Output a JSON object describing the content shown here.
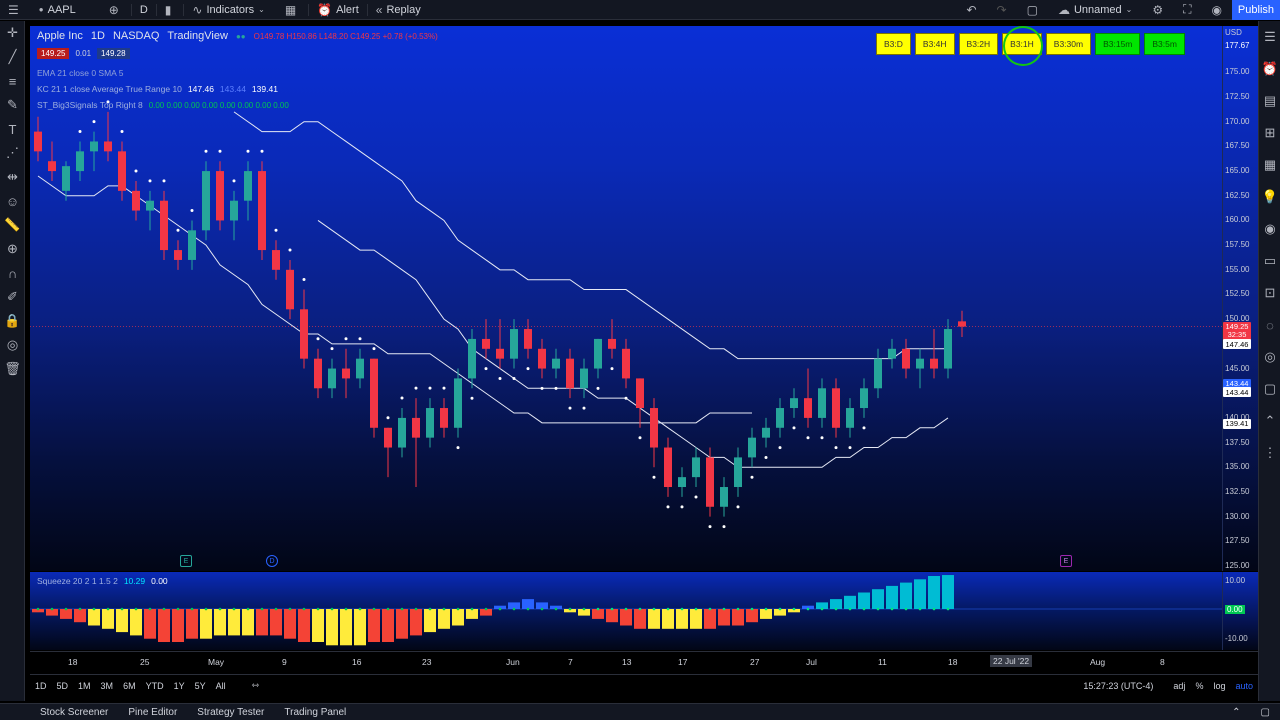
{
  "topbar": {
    "symbol": "AAPL",
    "interval": "D",
    "indicators": "Indicators",
    "alert": "Alert",
    "replay": "Replay",
    "layout_name": "Unnamed",
    "publish": "Publish"
  },
  "legend": {
    "company": "Apple Inc",
    "interval": "1D",
    "exchange": "NASDAQ",
    "source": "TradingView",
    "ohlc": "O149.78 H150.86 L148.20 C149.25 +0.78 (+0.53%)",
    "bid": "149.25",
    "spread": "0.01",
    "ask": "149.28",
    "ema": "EMA 21 close 0 SMA 5",
    "kc_label": "KC 21 1 close Average True Range 10",
    "kc_upper": "147.46",
    "kc_basis": "143.44",
    "kc_lower": "139.41",
    "st_label": "ST_Big3Signals Top Right 8",
    "st_values": "0.00 0.00 0.00 0.00 0.00 0.00 0.00 0.00",
    "squeeze_label": "Squeeze 20 2 1 1.5 2",
    "squeeze_value": "10.29",
    "squeeze_value2": "0.00"
  },
  "tf_buttons": [
    {
      "label": "B3:D",
      "color": "#ffff00"
    },
    {
      "label": "B3:4H",
      "color": "#ffff00"
    },
    {
      "label": "B3:2H",
      "color": "#ffff00"
    },
    {
      "label": "B3:1H",
      "color": "#ffff00"
    },
    {
      "label": "B3:30m",
      "color": "#ffff00"
    },
    {
      "label": "B3:15m",
      "color": "#00e600"
    },
    {
      "label": "B3:5m",
      "color": "#00e600"
    }
  ],
  "price_scale": {
    "currency": "USD",
    "top_value": "177.67",
    "ticks": [
      "175.00",
      "172.50",
      "170.00",
      "167.50",
      "165.00",
      "162.50",
      "160.00",
      "157.50",
      "155.00",
      "152.50",
      "150.00",
      "147.50",
      "145.00",
      "142.50",
      "140.00",
      "137.50",
      "135.00",
      "132.50",
      "130.00",
      "127.50",
      "125.00"
    ],
    "labels": [
      {
        "text": "149.25",
        "color": "#f23645",
        "value": 149.25
      },
      {
        "text": "32:35",
        "color": "#f23645",
        "value": 148.4
      },
      {
        "text": "147.46",
        "color": "#ffffff",
        "value": 147.46
      },
      {
        "text": "143.44",
        "color": "#2962ff",
        "value": 143.44
      },
      {
        "text": "143.44",
        "color": "#ffffff",
        "value": 142.6
      },
      {
        "text": "139.41",
        "color": "#ffffff",
        "value": 139.41
      }
    ]
  },
  "squeeze_scale": {
    "ticks": [
      "10.00",
      "0.00",
      "-10.00"
    ],
    "label": "10.29"
  },
  "chart_data": {
    "type": "candlestick",
    "ylim": [
      125,
      177.67
    ],
    "candles": [
      [
        169,
        170.5,
        166,
        167
      ],
      [
        166,
        168,
        164,
        165
      ],
      [
        163,
        166,
        162,
        165.5
      ],
      [
        165,
        168,
        164,
        167
      ],
      [
        167,
        169,
        165,
        168
      ],
      [
        168,
        171,
        166,
        167
      ],
      [
        167,
        168,
        162,
        163
      ],
      [
        163,
        164,
        160,
        161
      ],
      [
        161,
        163,
        159,
        162
      ],
      [
        162,
        163,
        156,
        157
      ],
      [
        157,
        158,
        155,
        156
      ],
      [
        156,
        160,
        155,
        159
      ],
      [
        159,
        166,
        158,
        165
      ],
      [
        165,
        166,
        159,
        160
      ],
      [
        160,
        163,
        158,
        162
      ],
      [
        162,
        166,
        160,
        165
      ],
      [
        165,
        166,
        156,
        157
      ],
      [
        157,
        158,
        154,
        155
      ],
      [
        155,
        156,
        150,
        151
      ],
      [
        151,
        153,
        145,
        146
      ],
      [
        146,
        147,
        142,
        143
      ],
      [
        143,
        146,
        142,
        145
      ],
      [
        145,
        147,
        142,
        144
      ],
      [
        144,
        147,
        143,
        146
      ],
      [
        146,
        146,
        138,
        139
      ],
      [
        139,
        139,
        134,
        137
      ],
      [
        137,
        141,
        136,
        140
      ],
      [
        140,
        142,
        133,
        138
      ],
      [
        138,
        142,
        137,
        141
      ],
      [
        141,
        142,
        138,
        139
      ],
      [
        139,
        145,
        138,
        144
      ],
      [
        144,
        149,
        143,
        148
      ],
      [
        148,
        150,
        146,
        147
      ],
      [
        147,
        150,
        145,
        146
      ],
      [
        146,
        150,
        145,
        149
      ],
      [
        149,
        150,
        146,
        147
      ],
      [
        147,
        148,
        144,
        145
      ],
      [
        145,
        147,
        144,
        146
      ],
      [
        146,
        147,
        142,
        143
      ],
      [
        143,
        146,
        142,
        145
      ],
      [
        145,
        148,
        144,
        148
      ],
      [
        148,
        150,
        146,
        147
      ],
      [
        147,
        148,
        143,
        144
      ],
      [
        144,
        144,
        139,
        141
      ],
      [
        141,
        142,
        135,
        137
      ],
      [
        137,
        138,
        132,
        133
      ],
      [
        133,
        135,
        132,
        134
      ],
      [
        134,
        137,
        133,
        136
      ],
      [
        136,
        137,
        130,
        131
      ],
      [
        131,
        134,
        130,
        133
      ],
      [
        133,
        137,
        132,
        136
      ],
      [
        136,
        139,
        135,
        138
      ],
      [
        138,
        140,
        137,
        139
      ],
      [
        139,
        142,
        138,
        141
      ],
      [
        141,
        143,
        140,
        142
      ],
      [
        142,
        145,
        139,
        140
      ],
      [
        140,
        144,
        139,
        143
      ],
      [
        143,
        144,
        138,
        139
      ],
      [
        139,
        142,
        138,
        141
      ],
      [
        141,
        144,
        140,
        143
      ],
      [
        143,
        147,
        142,
        146
      ],
      [
        146,
        148,
        145,
        147
      ],
      [
        147,
        148,
        144,
        145
      ],
      [
        145,
        147,
        143,
        146
      ],
      [
        146,
        149,
        144,
        145
      ],
      [
        145,
        150,
        144,
        149
      ],
      [
        149.78,
        150.86,
        148.2,
        149.25
      ]
    ],
    "kc_upper": [
      171,
      170,
      169,
      169,
      169,
      170,
      170,
      169,
      168,
      167,
      166,
      165,
      164,
      162,
      161,
      160,
      158,
      157,
      156,
      155,
      155,
      154,
      154,
      154,
      154,
      153,
      153,
      153,
      153,
      152,
      151,
      150,
      149,
      148,
      147,
      147,
      146,
      146,
      146,
      146,
      146,
      146,
      146,
      146,
      146,
      146,
      146,
      146,
      147,
      147,
      147,
      147
    ],
    "kc_lower": [
      160,
      159,
      158,
      157,
      157,
      156,
      155,
      154,
      152,
      150,
      149,
      147,
      146,
      145,
      144,
      143,
      143,
      143,
      143,
      143,
      142,
      142,
      142,
      141,
      140,
      139,
      138,
      137,
      136,
      136,
      135,
      135,
      135,
      135,
      135,
      135,
      135,
      136,
      136,
      137,
      137,
      138,
      138,
      139,
      139,
      140
    ],
    "squeeze_histogram": [
      -1,
      -2,
      -3,
      -4,
      -5,
      -6,
      -7,
      -8,
      -9,
      -10,
      -10,
      -9,
      -9,
      -8,
      -8,
      -8,
      -8,
      -8,
      -9,
      -10,
      -10,
      -11,
      -11,
      -11,
      -10,
      -10,
      -9,
      -8,
      -7,
      -6,
      -5,
      -3,
      -2,
      1,
      2,
      3,
      2,
      1,
      -1,
      -2,
      -3,
      -4,
      -5,
      -6,
      -6,
      -6,
      -6,
      -6,
      -6,
      -5,
      -5,
      -4,
      -3,
      -2,
      -1,
      1,
      2,
      3,
      4,
      5,
      6,
      7,
      8,
      9,
      10,
      10.29
    ]
  },
  "time_axis": {
    "labels": [
      "18",
      "25",
      "May",
      "9",
      "16",
      "23",
      "Jun",
      "7",
      "13",
      "17",
      "27",
      "Jul",
      "11",
      "18",
      "22 Jul '22",
      "Aug",
      "8"
    ]
  },
  "range_bar": {
    "ranges": [
      "1D",
      "5D",
      "1M",
      "3M",
      "6M",
      "YTD",
      "1Y",
      "5Y",
      "All"
    ],
    "clock": "15:27:23 (UTC-4)",
    "adj": "adj",
    "pct": "%",
    "log": "log",
    "auto": "auto"
  },
  "bottom_panel": {
    "tabs": [
      "Stock Screener",
      "Pine Editor",
      "Strategy Tester",
      "Trading Panel"
    ]
  },
  "colors": {
    "up": "#26a69a",
    "down": "#f23645",
    "accent": "#2962ff"
  }
}
